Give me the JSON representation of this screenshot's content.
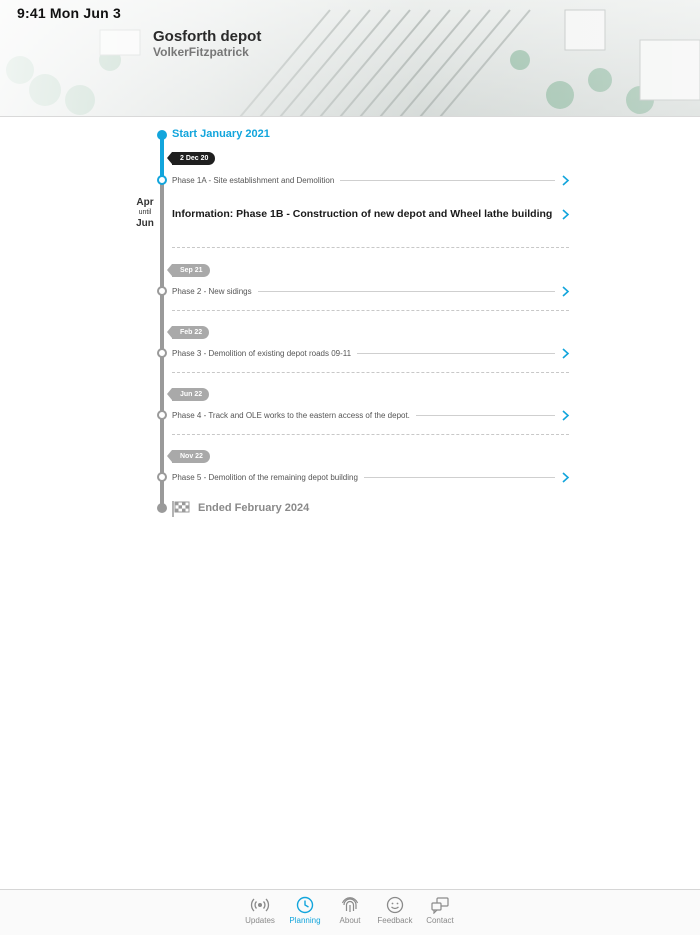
{
  "status_bar": {
    "time": "9:41  Mon Jun 3"
  },
  "header": {
    "title": "Gosforth depot",
    "subtitle": "VolkerFitzpatrick"
  },
  "timeline": {
    "start_label": "Start January 2021",
    "end_label": "Ended February 2024",
    "range": {
      "from": "Apr",
      "until": "until",
      "to": "Jun"
    },
    "info": {
      "label": "Information: Phase 1B - Construction of new depot and Wheel lathe building"
    },
    "phases": [
      {
        "date": "2 Dec 20",
        "label": "Phase 1A - Site establishment and Demolition"
      },
      {
        "date": "Sep 21",
        "label": "Phase 2 - New sidings"
      },
      {
        "date": "Feb 22",
        "label": "Phase 3 - Demolition of existing depot roads 09-11"
      },
      {
        "date": "Jun 22",
        "label": "Phase 4 - Track and OLE works to the eastern access of the depot."
      },
      {
        "date": "Nov 22",
        "label": "Phase 5 - Demolition of the remaining depot building"
      }
    ]
  },
  "tabbar": {
    "tabs": [
      {
        "label": "Updates",
        "icon": "broadcast-icon"
      },
      {
        "label": "Planning",
        "icon": "clock-icon",
        "active": true
      },
      {
        "label": "About",
        "icon": "fingerprint-icon"
      },
      {
        "label": "Feedback",
        "icon": "smiley-icon"
      },
      {
        "label": "Contact",
        "icon": "chat-icon"
      }
    ]
  },
  "colors": {
    "accent": "#12a5dc",
    "timeline_gray": "#9a9a9a",
    "tag_gray": "#a9a9a9",
    "tag_dark": "#1f1f1f"
  }
}
